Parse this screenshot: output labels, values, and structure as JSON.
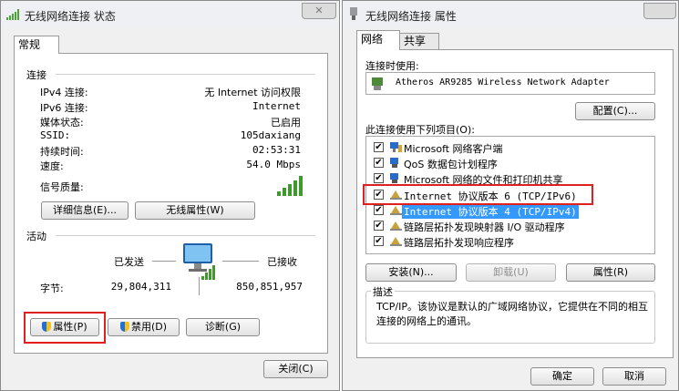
{
  "status_window": {
    "title": "无线网络连接 状态",
    "close_glyph": "✕",
    "tab": "常规",
    "connection": {
      "heading": "连接",
      "rows": [
        {
          "label": "IPv4 连接:",
          "value": "无 Internet 访问权限"
        },
        {
          "label": "IPv6 连接:",
          "value": "Internet"
        },
        {
          "label": "媒体状态:",
          "value": "已启用"
        },
        {
          "label": "SSID:",
          "value": "105daxiang"
        },
        {
          "label": "持续时间:",
          "value": "02:53:31"
        },
        {
          "label": "速度:",
          "value": "54.0 Mbps"
        }
      ],
      "signal_label": "信号质量:",
      "signal_bars": 5,
      "details_button": "详细信息(E)...",
      "wireless_props_button": "无线属性(W)"
    },
    "activity": {
      "heading": "活动",
      "sent_label": "已发送",
      "received_label": "已接收",
      "bytes_label": "字节:",
      "bytes_sent": "29,804,311",
      "bytes_received": "850,851,957"
    },
    "buttons": {
      "properties": "属性(P)",
      "disable": "禁用(D)",
      "diagnose": "诊断(G)",
      "close": "关闭(C)"
    }
  },
  "properties_window": {
    "title": "无线网络连接 属性",
    "tabs": [
      "网络",
      "共享"
    ],
    "connect_using_label": "连接时使用:",
    "adapter": "Atheros AR9285 Wireless Network Adapter",
    "configure_button": "配置(C)...",
    "items_label": "此连接使用下列项目(O):",
    "items": [
      {
        "label": "Microsoft 网络客户端",
        "checked": true,
        "icon": "network-client-icon"
      },
      {
        "label": "QoS 数据包计划程序",
        "checked": true,
        "icon": "network-service-icon"
      },
      {
        "label": "Microsoft 网络的文件和打印机共享",
        "checked": true,
        "icon": "network-service-icon"
      },
      {
        "label": "Internet 协议版本 6 (TCP/IPv6)",
        "checked": true,
        "icon": "protocol-icon"
      },
      {
        "label": "Internet 协议版本 4 (TCP/IPv4)",
        "checked": true,
        "icon": "protocol-icon",
        "selected": true
      },
      {
        "label": "链路层拓扑发现映射器 I/O 驱动程序",
        "checked": true,
        "icon": "protocol-icon"
      },
      {
        "label": "链路层拓扑发现响应程序",
        "checked": true,
        "icon": "protocol-icon"
      }
    ],
    "install_button": "安装(N)...",
    "uninstall_button": "卸载(U)",
    "properties_button": "属性(R)",
    "description_heading": "描述",
    "description": "TCP/IP。该协议是默认的广域网络协议，它提供在不同的相互连接的网络上的通讯。",
    "ok_button": "确定",
    "cancel_button": "取消"
  }
}
